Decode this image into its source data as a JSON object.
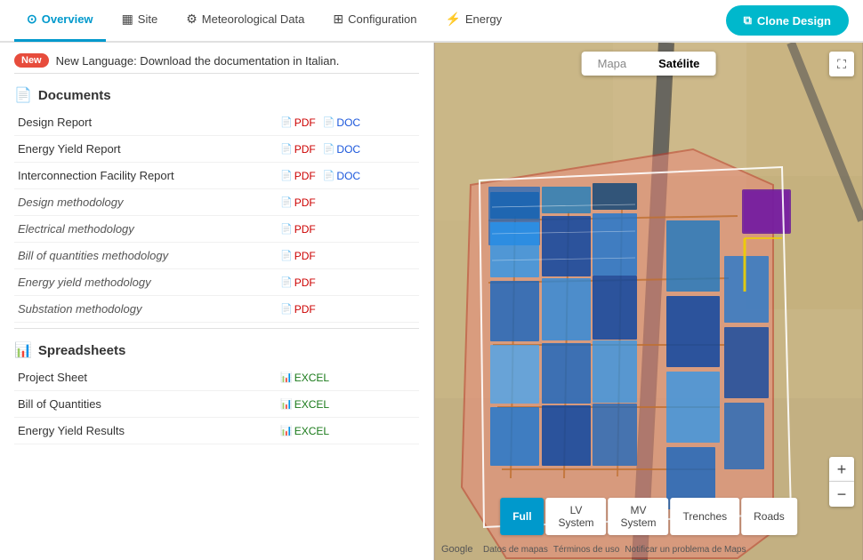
{
  "nav": {
    "items": [
      {
        "id": "overview",
        "label": "Overview",
        "icon": "⊙",
        "active": true
      },
      {
        "id": "site",
        "label": "Site",
        "icon": "🗺",
        "active": false
      },
      {
        "id": "meteorological",
        "label": "Meteorological Data",
        "icon": "⚙",
        "active": false
      },
      {
        "id": "configuration",
        "label": "Configuration",
        "icon": "⊞",
        "active": false
      },
      {
        "id": "energy",
        "label": "Energy",
        "icon": "⚡",
        "active": false
      }
    ],
    "clone_button": "Clone Design"
  },
  "notification": {
    "badge": "New",
    "text": "New Language: Download the documentation in Italian."
  },
  "documents": {
    "section_title": "Documents",
    "items": [
      {
        "name": "Design Report",
        "italic": false,
        "pdf": true,
        "doc": true
      },
      {
        "name": "Energy Yield Report",
        "italic": false,
        "pdf": true,
        "doc": true
      },
      {
        "name": "Interconnection Facility Report",
        "italic": false,
        "pdf": true,
        "doc": true
      },
      {
        "name": "Design methodology",
        "italic": true,
        "pdf": true,
        "doc": false
      },
      {
        "name": "Electrical methodology",
        "italic": true,
        "pdf": true,
        "doc": false
      },
      {
        "name": "Bill of quantities methodology",
        "italic": true,
        "pdf": true,
        "doc": false
      },
      {
        "name": "Energy yield methodology",
        "italic": true,
        "pdf": true,
        "doc": false
      },
      {
        "name": "Substation methodology",
        "italic": true,
        "pdf": true,
        "doc": false
      }
    ],
    "pdf_label": "PDF",
    "doc_label": "DOC"
  },
  "spreadsheets": {
    "section_title": "Spreadsheets",
    "items": [
      {
        "name": "Project Sheet",
        "excel": true
      },
      {
        "name": "Bill of Quantities",
        "excel": true
      },
      {
        "name": "Energy Yield Results",
        "excel": true
      }
    ],
    "excel_label": "EXCEL"
  },
  "map": {
    "toggle": {
      "mapa": "Mapa",
      "satelite": "Satélite",
      "active": "satelite"
    },
    "bottom_tabs": [
      {
        "label": "Full",
        "active": true
      },
      {
        "label": "LV System",
        "active": false
      },
      {
        "label": "MV System",
        "active": false
      },
      {
        "label": "Trenches",
        "active": false
      },
      {
        "label": "Roads",
        "active": false
      }
    ],
    "zoom_in": "+",
    "zoom_out": "−",
    "fullscreen": "⛶",
    "google_label": "Google",
    "map_links": [
      "Datos de mapas",
      "Términos de uso",
      "Notificar un problema de Maps"
    ]
  }
}
